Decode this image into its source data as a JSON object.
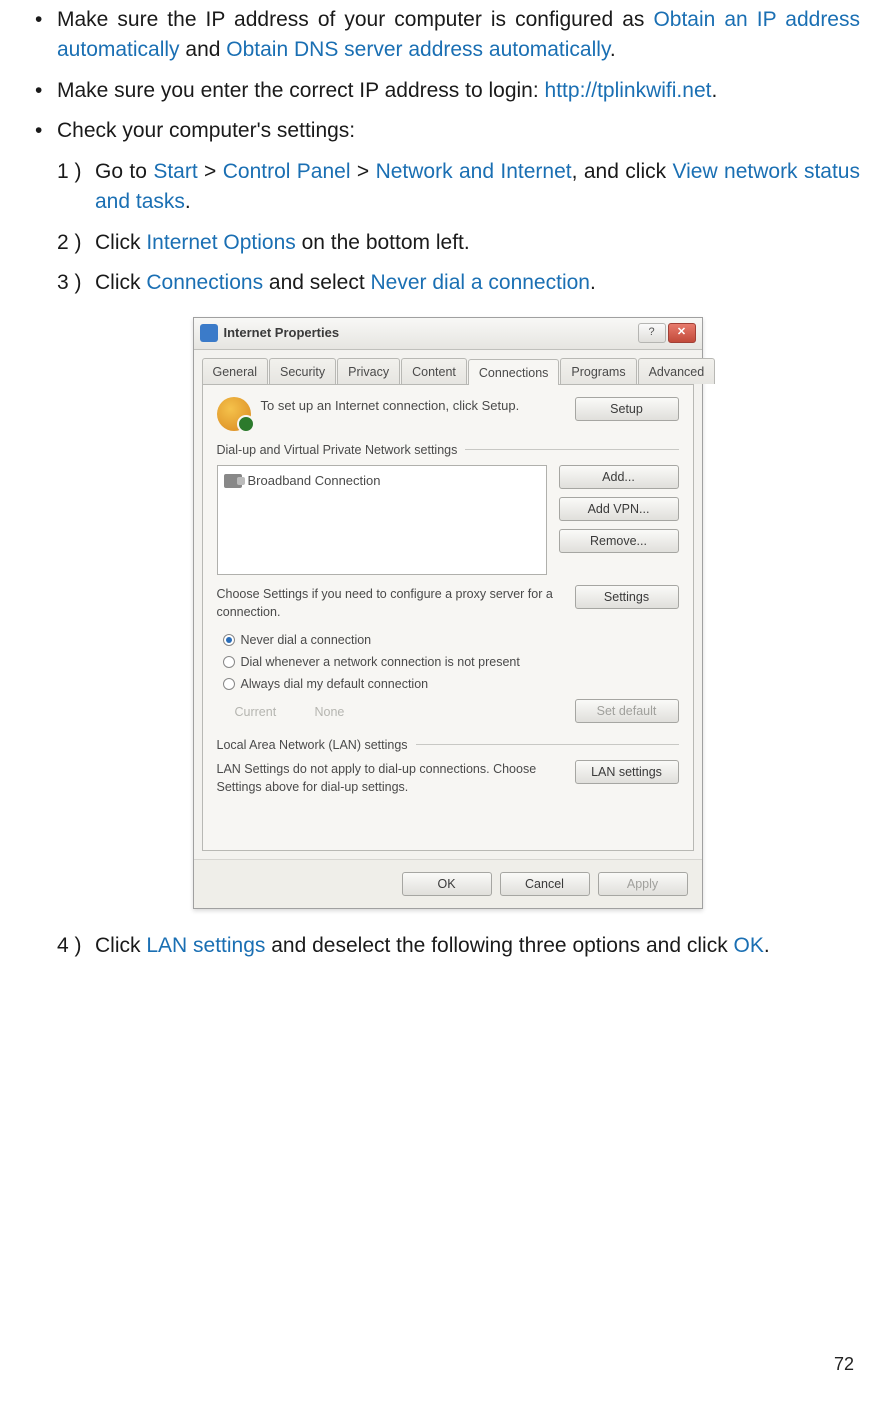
{
  "page_number": "72",
  "bullets": [
    {
      "prefix": "Make sure the IP address of your computer is configured as ",
      "link1": "Obtain an IP address automatically",
      "mid": " and ",
      "link2": "Obtain DNS server address automatically",
      "suffix": "."
    },
    {
      "prefix": "Make sure  you enter the correct IP address to login: ",
      "link1": "http://tplinkwifi.net",
      "suffix": "."
    },
    {
      "prefix": "Check your computer's settings:"
    }
  ],
  "steps": {
    "s1": {
      "num": "1 )",
      "a": "Go to ",
      "l1": "Start",
      "g1": " > ",
      "l2": "Control Panel",
      "g2": " > ",
      "l3": "Network and Internet",
      "b": ", and click ",
      "l4": "View network status and tasks",
      "c": "."
    },
    "s2": {
      "num": "2 )",
      "a": "Click ",
      "l1": "Internet Options",
      "b": " on the bottom left."
    },
    "s3": {
      "num": "3 )",
      "a": "Click ",
      "l1": "Connections",
      "b": " and select ",
      "l2": "Never dial a connection",
      "c": "."
    },
    "s4": {
      "num": "4 )",
      "a": "Click ",
      "l1": "LAN settings",
      "b": " and deselect the following three options and click ",
      "l2": "OK",
      "c": "."
    }
  },
  "dialog": {
    "title": "Internet Properties",
    "tabs": [
      "General",
      "Security",
      "Privacy",
      "Content",
      "Connections",
      "Programs",
      "Advanced"
    ],
    "setup_text": "To set up an Internet connection, click Setup.",
    "btn_setup": "Setup",
    "section_dialup": "Dial-up and Virtual Private Network settings",
    "conn_item": "Broadband Connection",
    "btn_add": "Add...",
    "btn_addvpn": "Add VPN...",
    "btn_remove": "Remove...",
    "settings_text": "Choose Settings if you need to configure a proxy server for a connection.",
    "btn_settings": "Settings",
    "radio1": "Never dial a connection",
    "radio2": "Dial whenever a network connection is not present",
    "radio3": "Always dial my default connection",
    "current_label": "Current",
    "current_value": "None",
    "btn_setdefault": "Set default",
    "section_lan": "Local Area Network (LAN) settings",
    "lan_text": "LAN Settings do not apply to dial-up connections. Choose Settings above for dial-up settings.",
    "btn_lan": "LAN settings",
    "btn_ok": "OK",
    "btn_cancel": "Cancel",
    "btn_apply": "Apply"
  }
}
